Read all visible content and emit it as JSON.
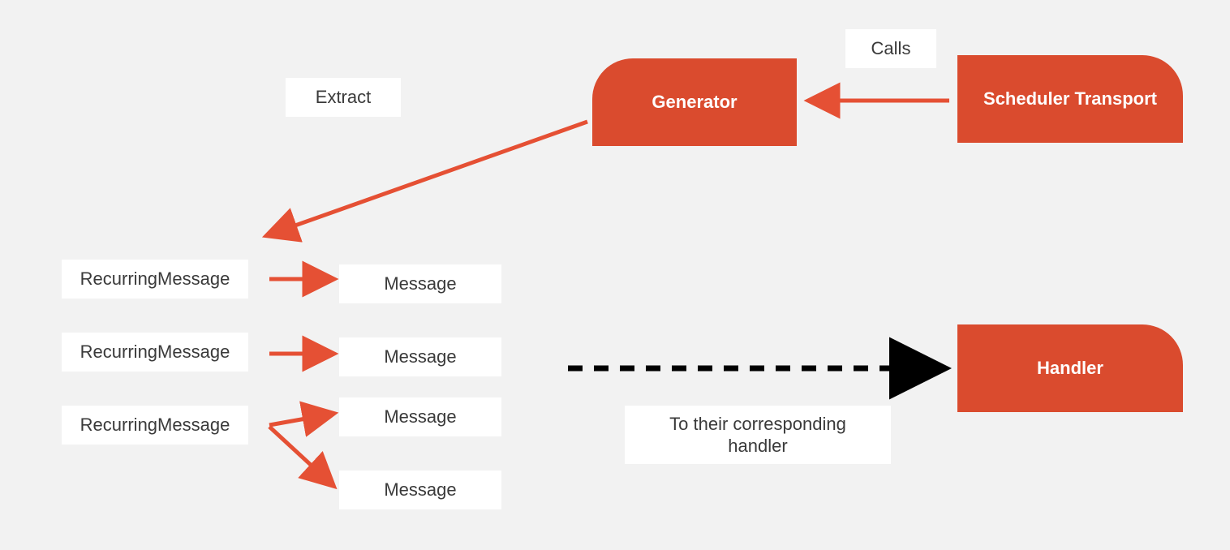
{
  "nodes": {
    "generator": "Generator",
    "scheduler_transport": "Scheduler Transport",
    "handler": "Handler"
  },
  "labels": {
    "extract": "Extract",
    "calls": "Calls",
    "to_handler_line1": "To their corresponding",
    "to_handler_line2": "handler"
  },
  "rows": [
    {
      "source": "RecurringMessage",
      "targets": [
        "Message"
      ]
    },
    {
      "source": "RecurringMessage",
      "targets": [
        "Message"
      ]
    },
    {
      "source": "RecurringMessage",
      "targets": [
        "Message",
        "Message"
      ]
    }
  ],
  "colors": {
    "accent": "#da4b2e",
    "bg": "#f2f2f2",
    "box": "#ffffff",
    "text": "#3a3a3a"
  }
}
